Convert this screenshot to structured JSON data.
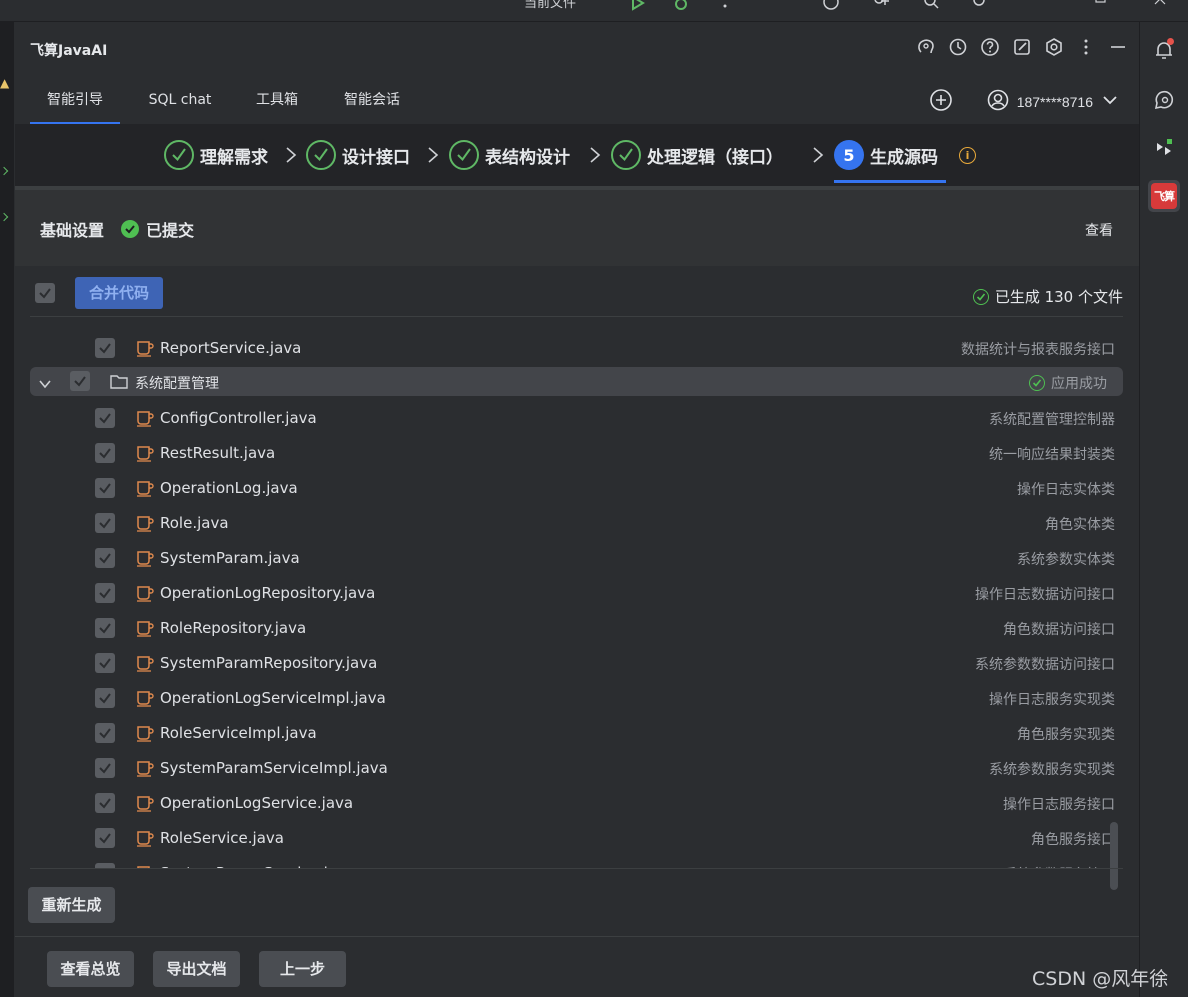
{
  "ide_top": {
    "partial_label": "当前文件"
  },
  "app": {
    "title": "飞算JavaAI"
  },
  "tabs": [
    {
      "label": "智能引导",
      "active": true
    },
    {
      "label": "SQL chat",
      "active": false
    },
    {
      "label": "工具箱",
      "active": false
    },
    {
      "label": "智能会话",
      "active": false
    }
  ],
  "user": {
    "label": "187****8716"
  },
  "steps": [
    {
      "label": "理解需求",
      "status": "done"
    },
    {
      "label": "设计接口",
      "status": "done"
    },
    {
      "label": "表结构设计",
      "status": "done"
    },
    {
      "label": "处理逻辑（接口）",
      "status": "done"
    },
    {
      "number": "5",
      "label": "生成源码",
      "status": "current"
    }
  ],
  "step_info_icon": "info-icon",
  "basic": {
    "title": "基础设置",
    "status": "已提交",
    "view": "查看"
  },
  "toolbar": {
    "merge": "合并代码",
    "gen_status": "已生成 130 个文件"
  },
  "folder": {
    "name": "系统配置管理",
    "status": "应用成功"
  },
  "files_before": [
    {
      "name": "ReportService.java",
      "desc": "数据统计与报表服务接口"
    }
  ],
  "files": [
    {
      "name": "ConfigController.java",
      "desc": "系统配置管理控制器"
    },
    {
      "name": "RestResult.java",
      "desc": "统一响应结果封装类"
    },
    {
      "name": "OperationLog.java",
      "desc": "操作日志实体类"
    },
    {
      "name": "Role.java",
      "desc": "角色实体类"
    },
    {
      "name": "SystemParam.java",
      "desc": "系统参数实体类"
    },
    {
      "name": "OperationLogRepository.java",
      "desc": "操作日志数据访问接口"
    },
    {
      "name": "RoleRepository.java",
      "desc": "角色数据访问接口"
    },
    {
      "name": "SystemParamRepository.java",
      "desc": "系统参数数据访问接口"
    },
    {
      "name": "OperationLogServiceImpl.java",
      "desc": "操作日志服务实现类"
    },
    {
      "name": "RoleServiceImpl.java",
      "desc": "角色服务实现类"
    },
    {
      "name": "SystemParamServiceImpl.java",
      "desc": "系统参数服务实现类"
    },
    {
      "name": "OperationLogService.java",
      "desc": "操作日志服务接口"
    },
    {
      "name": "RoleService.java",
      "desc": "角色服务接口"
    },
    {
      "name": "SystemParamService.java",
      "desc": "系统参数服务接口"
    }
  ],
  "buttons": {
    "regenerate": "重新生成",
    "overview": "查看总览",
    "export": "导出文档",
    "prev": "上一步"
  },
  "toolstrip": {
    "feisuan_label": "飞算"
  },
  "colors": {
    "accent": "#3574f0",
    "success": "#4fbf52",
    "java_icon": "#e08a4e"
  },
  "watermark": "CSDN @风年徐"
}
